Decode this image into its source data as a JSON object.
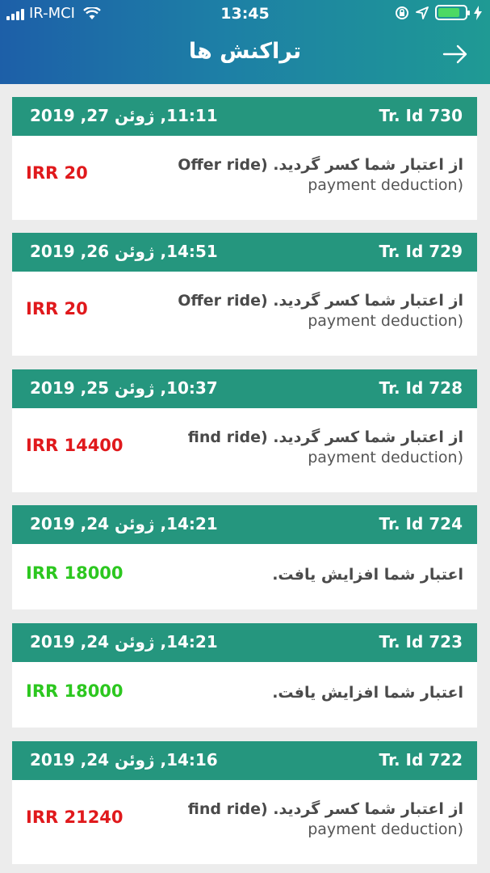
{
  "status_bar": {
    "carrier": "IR-MCI",
    "time": "13:45"
  },
  "nav": {
    "title": "تراکنش ها",
    "back_icon": "arrow-right-icon"
  },
  "colors": {
    "header_gradient": [
      "#1d5fa8",
      "#1f9a94"
    ],
    "card_header": "#25967e",
    "debit": "#e0191c",
    "credit": "#2cc71f"
  },
  "transactions": [
    {
      "id": "Tr. Id 730",
      "date": "11:11, ژوئن 27, 2019",
      "amount": "IRR 20",
      "type": "debit",
      "desc_line1": "از اعتبار شما کسر گردید. (Offer ride",
      "desc_line2": "payment deduction)"
    },
    {
      "id": "Tr. Id 729",
      "date": "14:51, ژوئن 26, 2019",
      "amount": "IRR 20",
      "type": "debit",
      "desc_line1": "از اعتبار شما کسر گردید. (Offer ride",
      "desc_line2": "payment deduction)"
    },
    {
      "id": "Tr. Id 728",
      "date": "10:37, ژوئن 25, 2019",
      "amount": "IRR 14400",
      "type": "debit",
      "desc_line1": "از اعتبار شما کسر گردید. (find ride",
      "desc_line2": "payment deduction)"
    },
    {
      "id": "Tr. Id 724",
      "date": "14:21, ژوئن 24, 2019",
      "amount": "IRR 18000",
      "type": "credit",
      "desc_line1": "اعتبار شما افزایش یافت.",
      "desc_line2": ""
    },
    {
      "id": "Tr. Id 723",
      "date": "14:21, ژوئن 24, 2019",
      "amount": "IRR 18000",
      "type": "credit",
      "desc_line1": "اعتبار شما افزایش یافت.",
      "desc_line2": ""
    },
    {
      "id": "Tr. Id 722",
      "date": "14:16, ژوئن 24, 2019",
      "amount": "IRR 21240",
      "type": "debit",
      "desc_line1": "از اعتبار شما کسر گردید. (find ride",
      "desc_line2": "payment deduction)"
    }
  ]
}
